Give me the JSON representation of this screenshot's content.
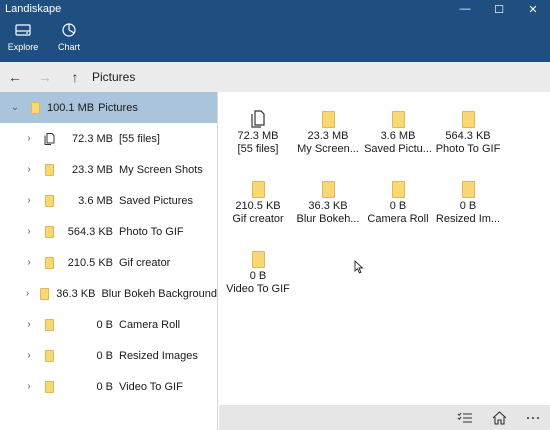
{
  "window": {
    "title": "Landiskape",
    "minimize_glyph": "—",
    "maximize_glyph": "☐",
    "close_glyph": "✕"
  },
  "ribbon": {
    "explore_label": "Explore",
    "explore_icon": "hard-drive-icon",
    "chart_label": "Chart",
    "chart_icon": "pie-chart-icon"
  },
  "nav": {
    "back_glyph": "←",
    "forward_glyph": "→",
    "up_glyph": "↑",
    "breadcrumb": "Pictures"
  },
  "tree": {
    "root": {
      "expander": "⌄",
      "size": "100.1 MB",
      "name": "Pictures"
    },
    "items": [
      {
        "expander": "›",
        "size": "72.3 MB",
        "name": "[55 files]",
        "icon": "files-icon"
      },
      {
        "expander": "›",
        "size": "23.3 MB",
        "name": "My Screen Shots",
        "icon": "folder-icon"
      },
      {
        "expander": "›",
        "size": "3.6 MB",
        "name": "Saved Pictures",
        "icon": "folder-icon"
      },
      {
        "expander": "›",
        "size": "564.3 KB",
        "name": "Photo To GIF",
        "icon": "folder-icon"
      },
      {
        "expander": "›",
        "size": "210.5 KB",
        "name": "Gif creator",
        "icon": "folder-icon"
      },
      {
        "expander": "›",
        "size": "36.3 KB",
        "name": "Blur Bokeh Background",
        "icon": "folder-icon"
      },
      {
        "expander": "›",
        "size": "0 B",
        "name": "Camera Roll",
        "icon": "folder-icon"
      },
      {
        "expander": "›",
        "size": "0 B",
        "name": "Resized Images",
        "icon": "folder-icon"
      },
      {
        "expander": "›",
        "size": "0 B",
        "name": "Video To GIF",
        "icon": "folder-icon"
      }
    ]
  },
  "tiles": [
    {
      "size": "72.3 MB",
      "name": "[55 files]",
      "icon": "files-icon"
    },
    {
      "size": "23.3 MB",
      "name": "My Screen...",
      "icon": "folder-icon"
    },
    {
      "size": "3.6 MB",
      "name": "Saved Pictu...",
      "icon": "folder-icon"
    },
    {
      "size": "564.3 KB",
      "name": "Photo To GIF",
      "icon": "folder-icon"
    },
    {
      "size": "210.5 KB",
      "name": "Gif creator",
      "icon": "folder-icon"
    },
    {
      "size": "36.3 KB",
      "name": "Blur Bokeh...",
      "icon": "folder-icon"
    },
    {
      "size": "0 B",
      "name": "Camera Roll",
      "icon": "folder-icon"
    },
    {
      "size": "0 B",
      "name": "Resized Im...",
      "icon": "folder-icon"
    },
    {
      "size": "0 B",
      "name": "Video To GIF",
      "icon": "folder-icon"
    }
  ],
  "bottombar": {
    "select_icon": "checklist-icon",
    "home_icon": "home-icon"
  },
  "colors": {
    "accent": "#1f4f80",
    "selection": "#aac4dc",
    "folder": "#f8d775"
  }
}
